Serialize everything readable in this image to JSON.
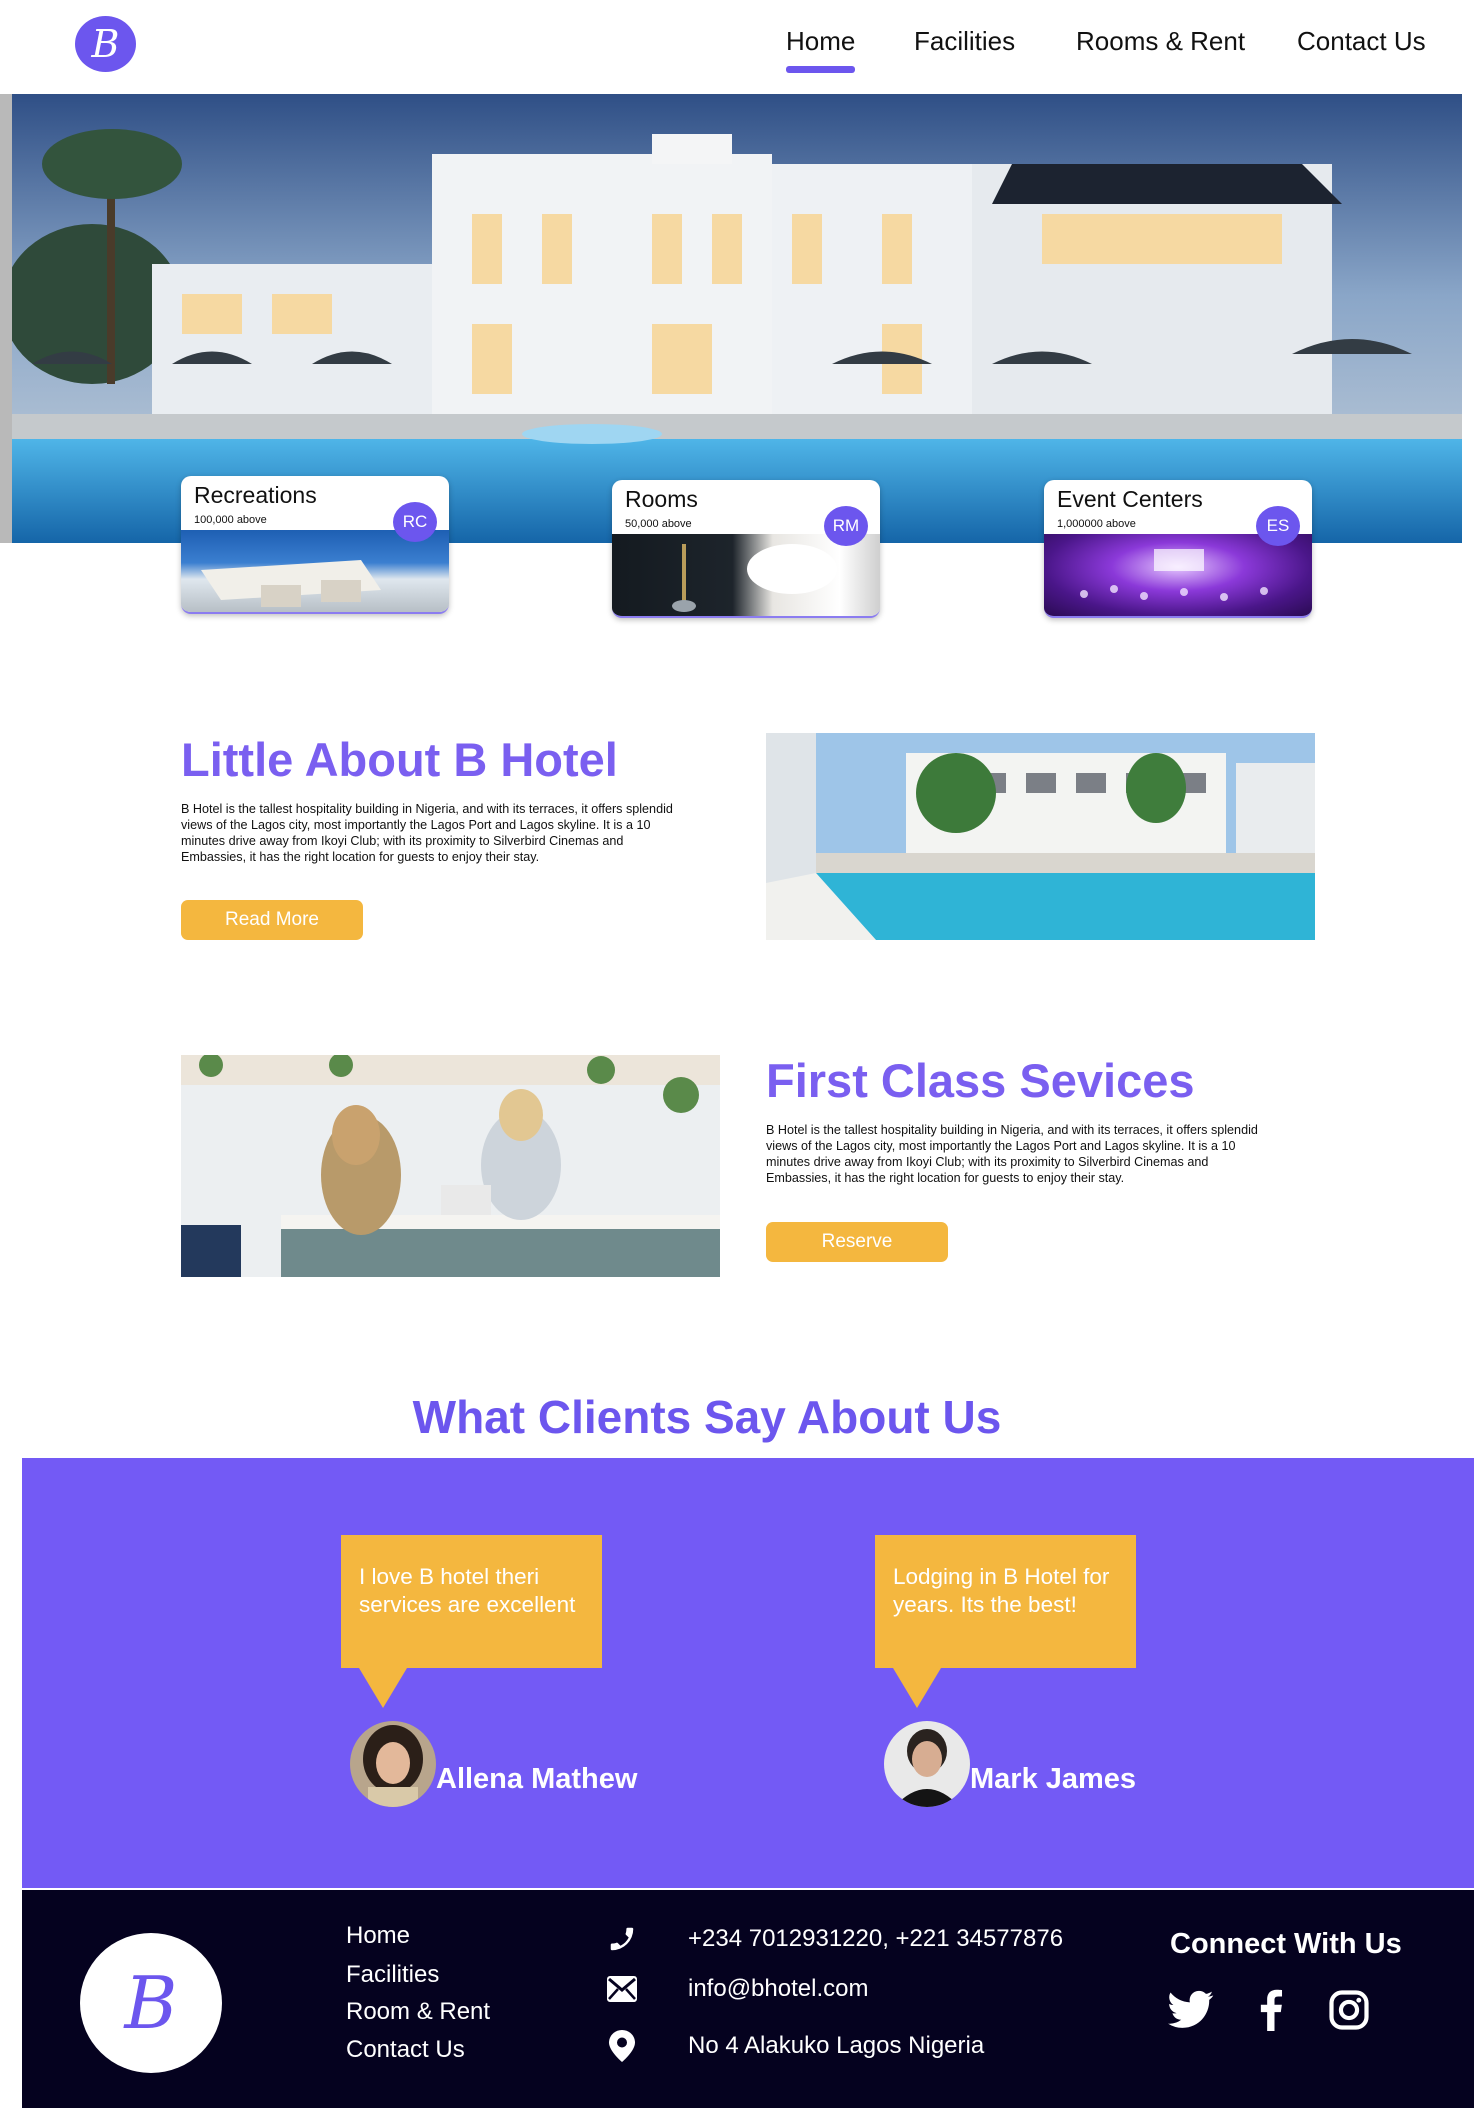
{
  "brand": {
    "logo_letter": "B",
    "accent": "#6c56ee",
    "button_color": "#f4b73f",
    "footer_bg": "#05021f"
  },
  "nav": {
    "items": [
      {
        "label": "Home",
        "active": true
      },
      {
        "label": "Facilities"
      },
      {
        "label": "Rooms & Rent"
      },
      {
        "label": "Contact Us"
      }
    ]
  },
  "categories": [
    {
      "title": "Recreations",
      "sub": "100,000 above",
      "badge": "RC"
    },
    {
      "title": "Rooms",
      "sub": "50,000 above",
      "badge": "RM"
    },
    {
      "title": "Event Centers",
      "sub": "1,000000 above",
      "badge": "ES"
    }
  ],
  "about": {
    "title": "Little About B Hotel",
    "text": "B Hotel  is the tallest hospitality building in Nigeria, and with its terraces, it offers splendid views of the Lagos city, most importantly the Lagos Port and Lagos skyline. It is a 10 minutes drive away from Ikoyi Club; with its proximity to Silverbird Cinemas and Embassies, it has the right location for guests to enjoy their stay.",
    "button": "Read More"
  },
  "services": {
    "title": "First Class Sevices",
    "text": "B Hotel  is the tallest hospitality building in Nigeria, and with its terraces, it offers splendid views of the Lagos city, most importantly the Lagos Port and Lagos skyline. It is a 10 minutes drive away from Ikoyi Club; with its proximity to Silverbird Cinemas and Embassies, it has the right location for guests to enjoy their stay.",
    "button": "Reserve"
  },
  "testimonials": {
    "heading": "What Clients Say About Us",
    "items": [
      {
        "quote": "I love B hotel theri services are excellent",
        "name": "Allena Mathew"
      },
      {
        "quote": "Lodging in B Hotel for years. Its the best!",
        "name": "Mark James"
      }
    ]
  },
  "footer": {
    "logo_letter": "B",
    "links": [
      "Home",
      "Facilities",
      "Room & Rent",
      "Contact Us"
    ],
    "contact": {
      "phone": "+234 7012931220, +221 34577876",
      "email": "info@bhotel.com",
      "address": "No 4 Alakuko Lagos Nigeria"
    },
    "connect_title": "Connect With Us",
    "social": [
      "twitter-icon",
      "facebook-icon",
      "instagram-icon"
    ]
  }
}
